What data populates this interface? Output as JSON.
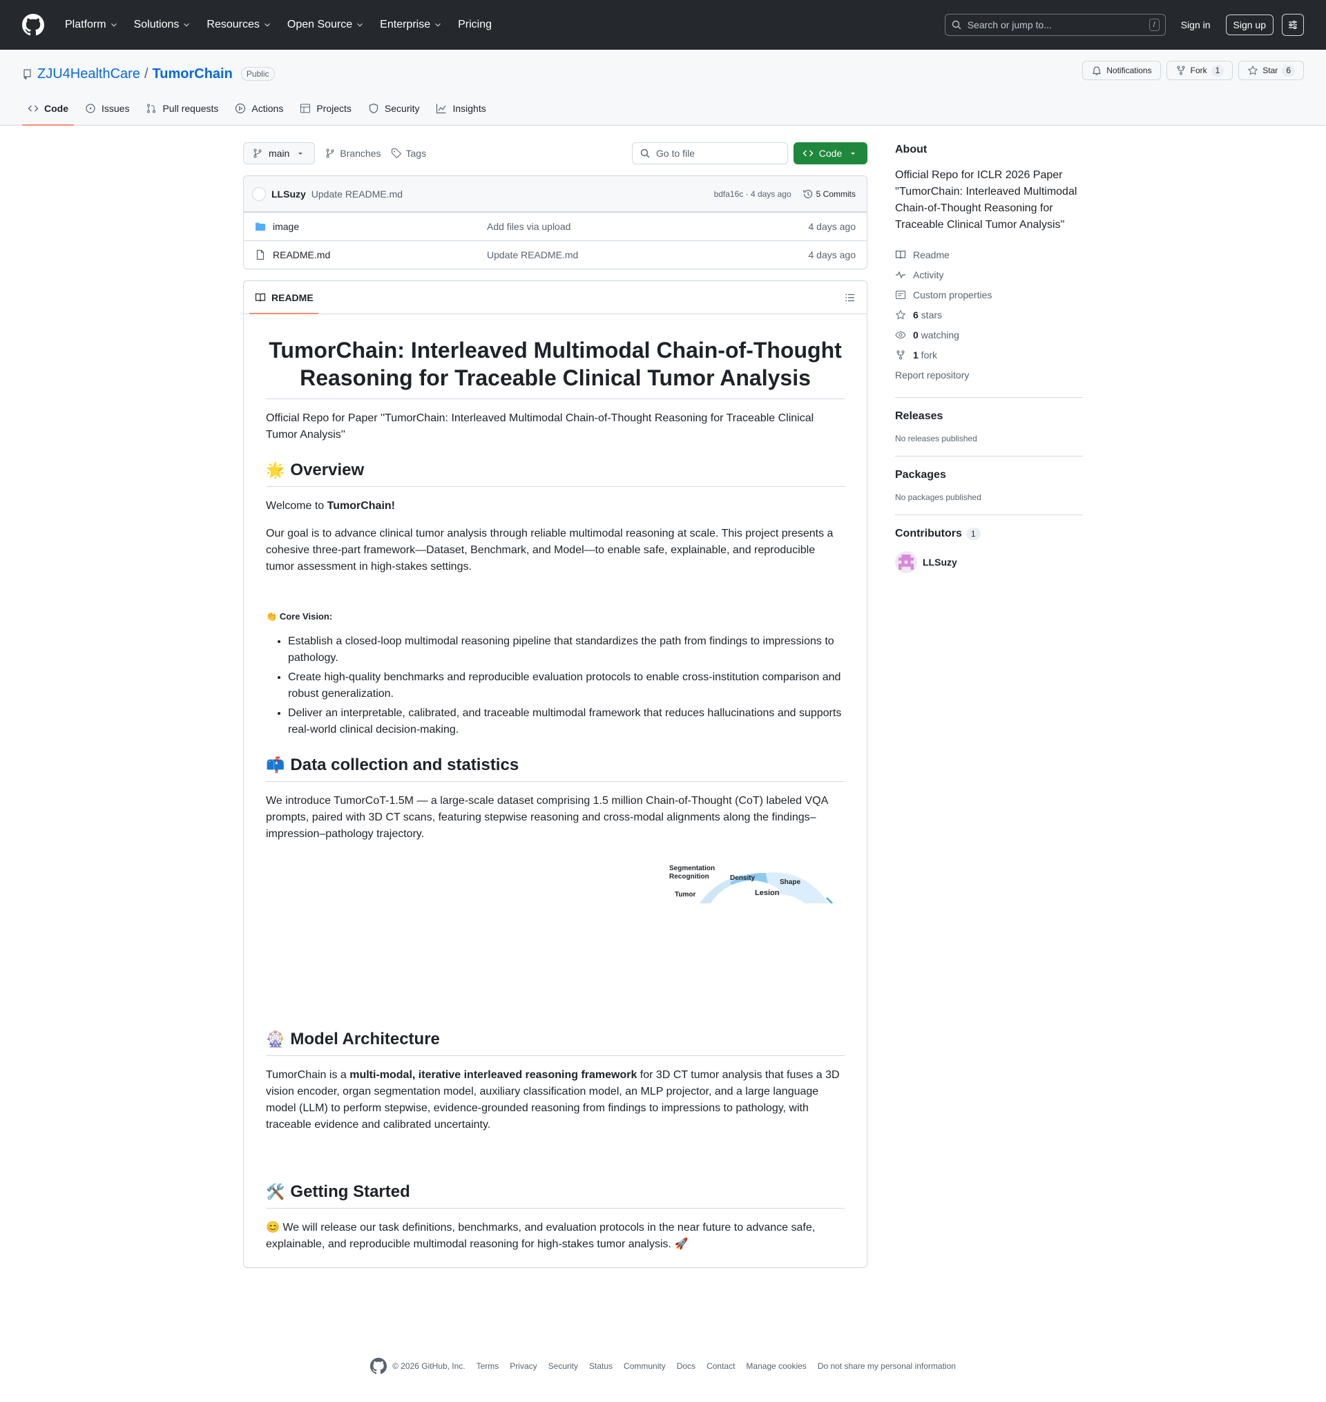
{
  "header": {
    "nav": [
      "Platform",
      "Solutions",
      "Resources",
      "Open Source",
      "Enterprise",
      "Pricing"
    ],
    "search_placeholder": "Search or jump to...",
    "search_shortcut": "/",
    "sign_in": "Sign in",
    "sign_up": "Sign up"
  },
  "repo": {
    "owner": "ZJU4HealthCare",
    "sep": "/",
    "name": "TumorChain",
    "visibility": "Public",
    "notifications": "Notifications",
    "fork_label": "Fork",
    "fork_count": "1",
    "star_label": "Star",
    "star_count": "6",
    "tabs": [
      "Code",
      "Issues",
      "Pull requests",
      "Actions",
      "Projects",
      "Security",
      "Insights"
    ]
  },
  "toolbar": {
    "branch": "main",
    "branches": "Branches",
    "tags": "Tags",
    "goto_placeholder": "Go to file",
    "code_btn": "Code"
  },
  "commit": {
    "author": "LLSuzy",
    "message": "Update README.md",
    "meta": "bdfa16c · 4 days ago",
    "commits": "5 Commits"
  },
  "files": [
    {
      "name": "image",
      "type": "folder",
      "message": "Add files via upload",
      "date": "4 days ago"
    },
    {
      "name": "README.md",
      "type": "file",
      "message": "Update README.md",
      "date": "4 days ago"
    }
  ],
  "readme": {
    "tab": "README",
    "title": "TumorChain: Interleaved Multimodal Chain-of-Thought Reasoning for Traceable Clinical Tumor Analysis",
    "intro": "Official Repo for Paper ''TumorChain: Interleaved Multimodal Chain-of-Thought Reasoning for Traceable Clinical Tumor Analysis''",
    "overview_emoji": "🌟",
    "overview_h": "Overview",
    "welcome_prefix": "Welcome to ",
    "welcome_bold": "TumorChain!",
    "goal": "Our goal is to advance clinical tumor analysis through reliable multimodal reasoning at scale. This project presents a cohesive three-part framework—Dataset, Benchmark, and Model—to enable safe, explainable, and reproducible tumor assessment in high-stakes settings.",
    "core_emoji": "👏",
    "core_label": "Core Vision:",
    "bullets": [
      "Establish a closed-loop multimodal reasoning pipeline that standardizes the path from findings to impressions to pathology.",
      "Create high-quality benchmarks and reproducible evaluation protocols to enable cross-institution comparison and robust generalization.",
      "Deliver an interpretable, calibrated, and traceable multimodal framework that reduces hallucinations and supports real-world clinical decision-making."
    ],
    "data_emoji": "📫",
    "data_h": "Data collection and statistics",
    "data_p": "We introduce TumorCoT-1.5M — a large-scale dataset comprising 1.5 million Chain-of-Thought (CoT) labeled VQA prompts, paired with 3D CT scans, featuring stepwise reasoning and cross-modal alignments along the findings–impression–pathology trajectory.",
    "figure_labels": [
      "Segmentation",
      "Recognition",
      "Density",
      "Shape",
      "Tumor",
      "Lesion"
    ],
    "model_emoji": "🎡",
    "model_h": "Model Architecture",
    "model_prefix": "TumorChain is a ",
    "model_bold": "multi-modal, iterative interleaved reasoning framework",
    "model_suffix": " for 3D CT tumor analysis that fuses a 3D vision encoder, organ segmentation model, auxiliary classification model, an MLP projector, and a large language model (LLM) to perform stepwise, evidence-grounded reasoning from findings to impressions to pathology, with traceable evidence and calibrated uncertainty.",
    "start_emoji": "🛠️",
    "start_h": "Getting Started",
    "start_p_emoji": "😊",
    "start_p": " We will release our task definitions, benchmarks, and evaluation protocols in the near future to advance safe, explainable, and reproducible multimodal reasoning for high-stakes tumor analysis. ",
    "start_p_end": "🚀"
  },
  "sidebar": {
    "about_h": "About",
    "about_desc": "Official Repo for ICLR 2026 Paper ''TumorChain: Interleaved Multimodal Chain-of-Thought Reasoning for Traceable Clinical Tumor Analysis''",
    "readme": "Readme",
    "activity": "Activity",
    "custom_props": "Custom properties",
    "stars_n": "6",
    "stars": " stars",
    "watching_n": "0",
    "watching": " watching",
    "fork_n": "1",
    "fork": " fork",
    "report": "Report repository",
    "releases_h": "Releases",
    "releases_none": "No releases published",
    "packages_h": "Packages",
    "packages_none": "No packages published",
    "contributors_h": "Contributors",
    "contributors_n": "1",
    "contributor": "LLSuzy"
  },
  "footer": {
    "copy": "© 2026 GitHub, Inc.",
    "links": [
      "Terms",
      "Privacy",
      "Security",
      "Status",
      "Community",
      "Docs",
      "Contact",
      "Manage cookies",
      "Do not share my personal information"
    ]
  }
}
